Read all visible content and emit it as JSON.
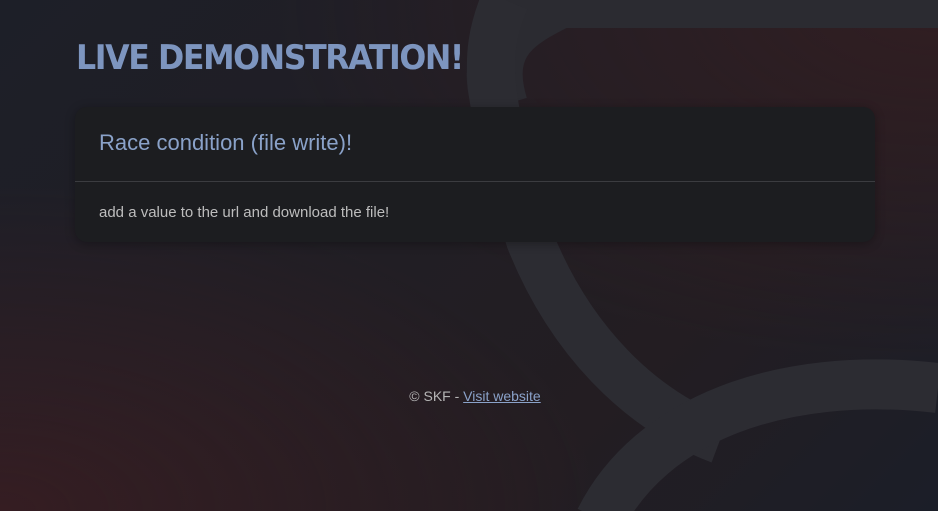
{
  "header": {
    "title": "LIVE DEMONSTRATION!"
  },
  "card": {
    "title": "Race condition (file write)!",
    "description": "add a value to the url and download the file!"
  },
  "footer": {
    "copyright": "© SKF - ",
    "link_label": "Visit website"
  },
  "colors": {
    "accent": "#8aa2c9",
    "title": "#7d95bf",
    "card_background": "#1c1d20",
    "page_background": "#1f1f26"
  }
}
